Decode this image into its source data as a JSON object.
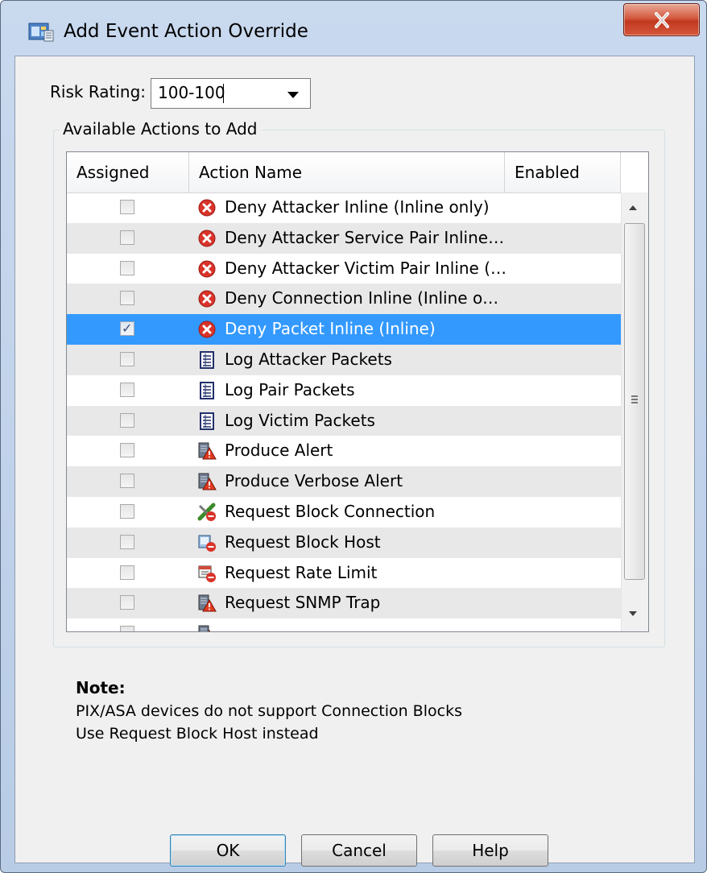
{
  "window": {
    "title": "Add Event Action Override",
    "close_icon": "close-icon"
  },
  "risk": {
    "label": "Risk Rating:",
    "value": "100-100"
  },
  "group": {
    "legend": "Available Actions to Add"
  },
  "table": {
    "headers": {
      "assigned": "Assigned",
      "action_name": "Action Name",
      "enabled": "Enabled"
    },
    "rows": [
      {
        "assigned": false,
        "icon": "deny-icon",
        "name": "Deny Attacker Inline (Inline only)",
        "enabled": true
      },
      {
        "assigned": false,
        "icon": "deny-icon",
        "name": "Deny Attacker Service Pair Inline…",
        "enabled": true
      },
      {
        "assigned": false,
        "icon": "deny-icon",
        "name": "Deny Attacker Victim Pair Inline (…",
        "enabled": true
      },
      {
        "assigned": false,
        "icon": "deny-icon",
        "name": "Deny Connection Inline (Inline o…",
        "enabled": true
      },
      {
        "assigned": true,
        "icon": "deny-icon",
        "name": "Deny Packet Inline (Inline)",
        "enabled": true,
        "selected": true
      },
      {
        "assigned": false,
        "icon": "log-icon",
        "name": "Log Attacker Packets",
        "enabled": true
      },
      {
        "assigned": false,
        "icon": "log-icon",
        "name": "Log Pair Packets",
        "enabled": true
      },
      {
        "assigned": false,
        "icon": "log-icon",
        "name": "Log Victim Packets",
        "enabled": true
      },
      {
        "assigned": false,
        "icon": "alert-icon",
        "name": "Produce Alert",
        "enabled": true
      },
      {
        "assigned": false,
        "icon": "alert-icon",
        "name": "Produce Verbose Alert",
        "enabled": true
      },
      {
        "assigned": false,
        "icon": "block-connection-icon",
        "name": "Request Block Connection",
        "enabled": true
      },
      {
        "assigned": false,
        "icon": "block-host-icon",
        "name": "Request Block Host",
        "enabled": true
      },
      {
        "assigned": false,
        "icon": "rate-limit-icon",
        "name": "Request Rate Limit",
        "enabled": true
      },
      {
        "assigned": false,
        "icon": "alert-icon",
        "name": "Request SNMP Trap",
        "enabled": true
      },
      {
        "assigned": false,
        "icon": "alert-icon",
        "name": "",
        "enabled": true
      }
    ]
  },
  "note": {
    "title": "Note:",
    "line1": "PIX/ASA devices do not support Connection Blocks",
    "line2": "Use Request Block Host instead"
  },
  "buttons": {
    "ok": "OK",
    "cancel": "Cancel",
    "help": "Help"
  },
  "colors": {
    "selection": "#3399ff",
    "deny_red": "#d9332a",
    "title_bar": "#c9d9ee"
  }
}
